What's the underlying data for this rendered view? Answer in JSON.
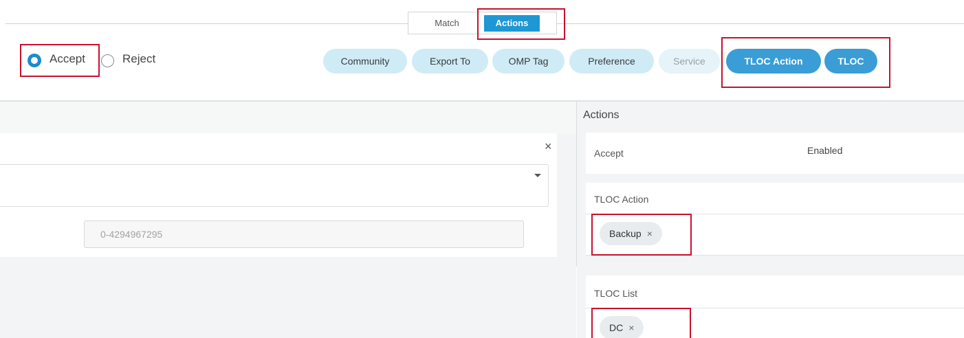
{
  "tabs": {
    "match": "Match",
    "actions": "Actions"
  },
  "decision": {
    "accept": "Accept",
    "reject": "Reject",
    "selected": "Accept"
  },
  "action_pills": [
    {
      "label": "Community",
      "state": "available"
    },
    {
      "label": "Export To",
      "state": "available"
    },
    {
      "label": "OMP Tag",
      "state": "available"
    },
    {
      "label": "Preference",
      "state": "available"
    },
    {
      "label": "Service",
      "state": "disabled"
    },
    {
      "label": "TLOC Action",
      "state": "selected"
    },
    {
      "label": "TLOC",
      "state": "selected"
    }
  ],
  "left_form": {
    "close_symbol": "×",
    "number_placeholder": "0-4294967295"
  },
  "actions_panel": {
    "title": "Actions",
    "accept_label": "Accept",
    "accept_value": "Enabled",
    "tloc_action_label": "TLOC Action",
    "tloc_action_chip": "Backup",
    "tloc_list_label": "TLOC List",
    "tloc_list_chip": "DC",
    "chip_remove": "×"
  },
  "colors": {
    "accent": "#1d98d4",
    "pill_light": "#cfecf6",
    "pill_active": "#3a9dd6",
    "highlight": "#c8102e"
  }
}
